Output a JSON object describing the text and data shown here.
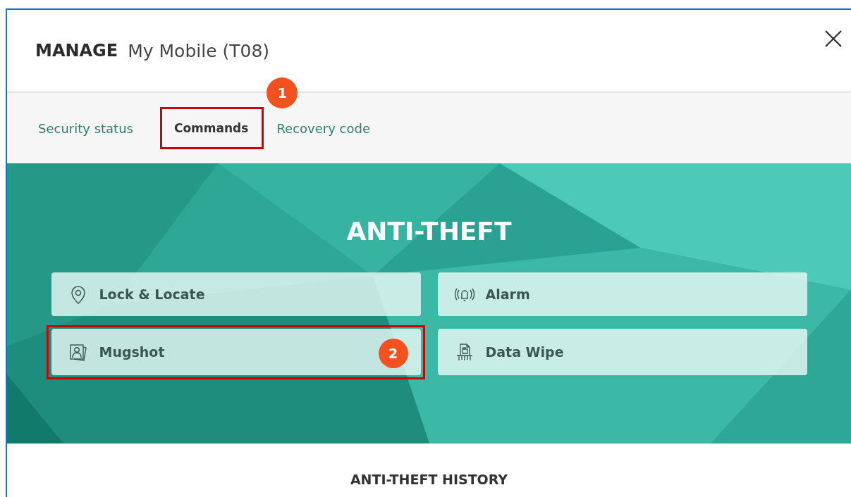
{
  "header": {
    "title": "MANAGE",
    "device": "My Mobile (T08)"
  },
  "tabs": [
    {
      "label": "Security status",
      "selected": false
    },
    {
      "label": "Commands",
      "selected": true,
      "callout": "1"
    },
    {
      "label": "Recovery code",
      "selected": false
    }
  ],
  "hero": {
    "title": "ANTI-THEFT"
  },
  "commands": [
    {
      "label": "Lock & Locate",
      "kind": "pin"
    },
    {
      "label": "Alarm",
      "kind": "bell"
    },
    {
      "label": "Mugshot",
      "kind": "photos",
      "callout": "2"
    },
    {
      "label": "Data Wipe",
      "kind": "shredder"
    }
  ],
  "history": {
    "title": "ANTI-THEFT HISTORY"
  }
}
